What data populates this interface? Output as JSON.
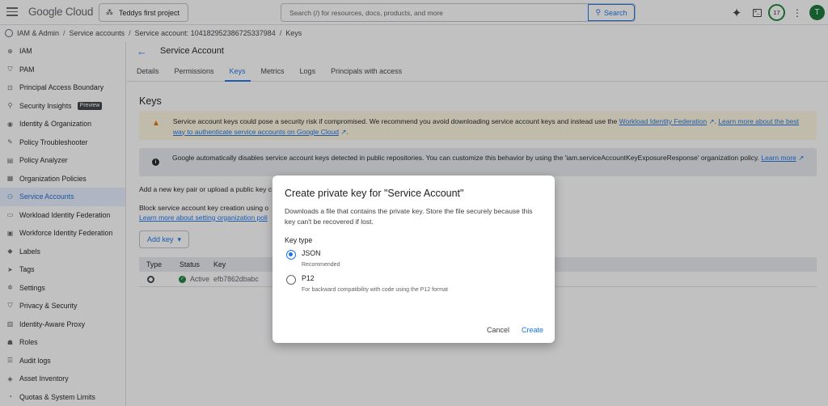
{
  "topbar": {
    "logo": "Google Cloud",
    "project": "Teddys first project",
    "search_placeholder": "Search (/) for resources, docs, products, and more",
    "search_button": "Search",
    "notifications_count": "17",
    "avatar_letter": "T"
  },
  "breadcrumb": [
    "IAM & Admin",
    "Service accounts",
    "Service account: 104182952386725337984",
    "Keys"
  ],
  "sidebar": {
    "items": [
      {
        "label": "IAM",
        "icon": "person-add-icon"
      },
      {
        "label": "PAM",
        "icon": "shield-icon"
      },
      {
        "label": "Principal Access Boundary",
        "icon": "lock-icon"
      },
      {
        "label": "Security Insights",
        "icon": "search-icon",
        "badge": "Preview"
      },
      {
        "label": "Identity & Organization",
        "icon": "account-circle-icon"
      },
      {
        "label": "Policy Troubleshooter",
        "icon": "wrench-icon"
      },
      {
        "label": "Policy Analyzer",
        "icon": "document-icon"
      },
      {
        "label": "Organization Policies",
        "icon": "list-icon"
      },
      {
        "label": "Service Accounts",
        "icon": "service-account-icon",
        "active": true
      },
      {
        "label": "Workload Identity Federation",
        "icon": "id-card-icon"
      },
      {
        "label": "Workforce Identity Federation",
        "icon": "grid-icon"
      },
      {
        "label": "Labels",
        "icon": "label-icon"
      },
      {
        "label": "Tags",
        "icon": "tag-icon"
      },
      {
        "label": "Settings",
        "icon": "gear-icon"
      },
      {
        "label": "Privacy & Security",
        "icon": "shield-icon"
      },
      {
        "label": "Identity-Aware Proxy",
        "icon": "proxy-icon"
      },
      {
        "label": "Roles",
        "icon": "hat-icon"
      },
      {
        "label": "Audit logs",
        "icon": "list-icon"
      },
      {
        "label": "Asset Inventory",
        "icon": "diamond-icon"
      },
      {
        "label": "Quotas & System Limits",
        "icon": "gauge-icon"
      }
    ]
  },
  "main": {
    "title": "Service Account",
    "tabs": [
      "Details",
      "Permissions",
      "Keys",
      "Metrics",
      "Logs",
      "Principals with access"
    ],
    "active_tab": "Keys",
    "heading": "Keys",
    "warning": {
      "text": "Service account keys could pose a security risk if compromised. We recommend you avoid downloading service account keys and instead use the",
      "link1": "Workload Identity Federation",
      "sep": ". ",
      "link2": "Learn more about the best way to authenticate service accounts on Google Cloud",
      "end": "."
    },
    "info": {
      "text": "Google automatically disables service account keys detected in public repositories. You can customize this behavior by using the 'iam.serviceAccountKeyExposureResponse' organization policy.",
      "link": "Learn more"
    },
    "add_pair_text": "Add a new key pair or upload a public key c",
    "block_text": "Block service account key creation using o",
    "block_link": "Learn more about setting organization poli",
    "add_key_button": "Add key",
    "table": {
      "headers": [
        "Type",
        "Status",
        "Key"
      ],
      "rows": [
        {
          "status": "Active",
          "key": "efb7862dbabc"
        }
      ]
    }
  },
  "dialog": {
    "title": "Create private key for \"Service Account\"",
    "description": "Downloads a file that contains the private key. Store the file securely because this key can't be recovered if lost.",
    "key_type_label": "Key type",
    "options": [
      {
        "label": "JSON",
        "sub": "Recommended",
        "checked": true
      },
      {
        "label": "P12",
        "sub": "For backward compatibility with code using the P12 format",
        "checked": false
      }
    ],
    "cancel": "Cancel",
    "create": "Create"
  },
  "colors": {
    "accent": "#1a73e8",
    "active_bg": "#e8f0fe",
    "warn_bg": "#fef7e0",
    "success": "#188038"
  }
}
